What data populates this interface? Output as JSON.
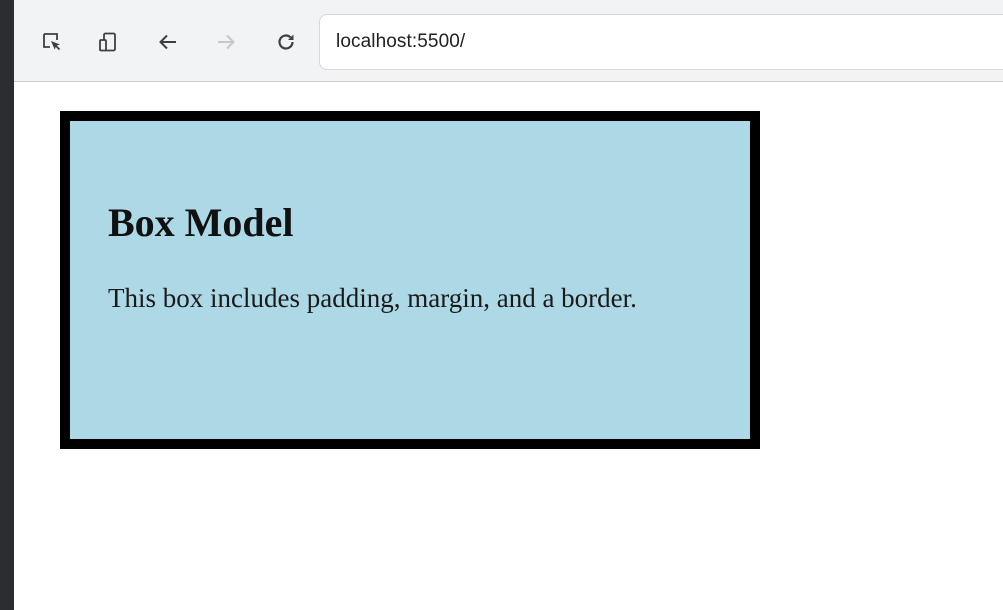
{
  "browser": {
    "address": "localhost:5500/",
    "toolbar": {
      "inspect_icon": "inspect-element-icon",
      "device_icon": "device-toolbar-icon",
      "back_icon": "back-arrow-icon",
      "forward_icon": "forward-arrow-icon",
      "reload_icon": "reload-icon"
    }
  },
  "page": {
    "box": {
      "heading": "Box Model",
      "text": "This box includes padding, margin, and a border.",
      "background_color": "#add8e6",
      "border_color": "#000000"
    }
  }
}
